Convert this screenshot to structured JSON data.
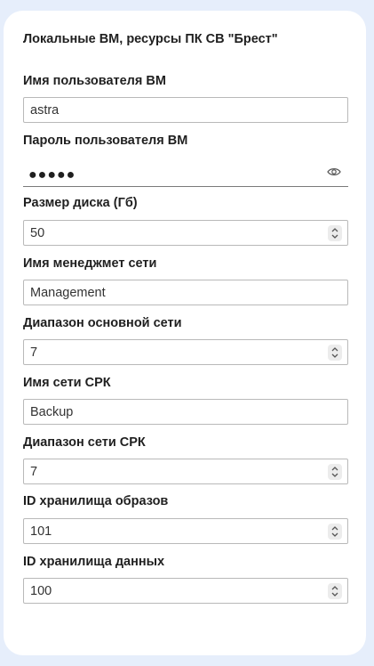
{
  "form": {
    "title": "Локальные ВМ, ресурсы ПК СВ \"Брест\"",
    "username": {
      "label": "Имя пользователя ВМ",
      "value": "astra"
    },
    "password": {
      "label": "Пароль пользователя ВМ",
      "masked_value": "●●●●●",
      "icon": "eye-icon"
    },
    "disk_size": {
      "label": "Размер диска (Гб)",
      "value": "50"
    },
    "mgmt_net_name": {
      "label": "Имя менеджмет сети",
      "value": "Management"
    },
    "main_net_range": {
      "label": "Диапазон основной сети",
      "value": "7"
    },
    "srk_net_name": {
      "label": "Имя сети СРК",
      "value": "Backup"
    },
    "srk_net_range": {
      "label": "Диапазон сети СРК",
      "value": "7"
    },
    "image_store_id": {
      "label": "ID хранилища образов",
      "value": "101"
    },
    "data_store_id": {
      "label": "ID хранилища данных",
      "value": "100"
    }
  }
}
